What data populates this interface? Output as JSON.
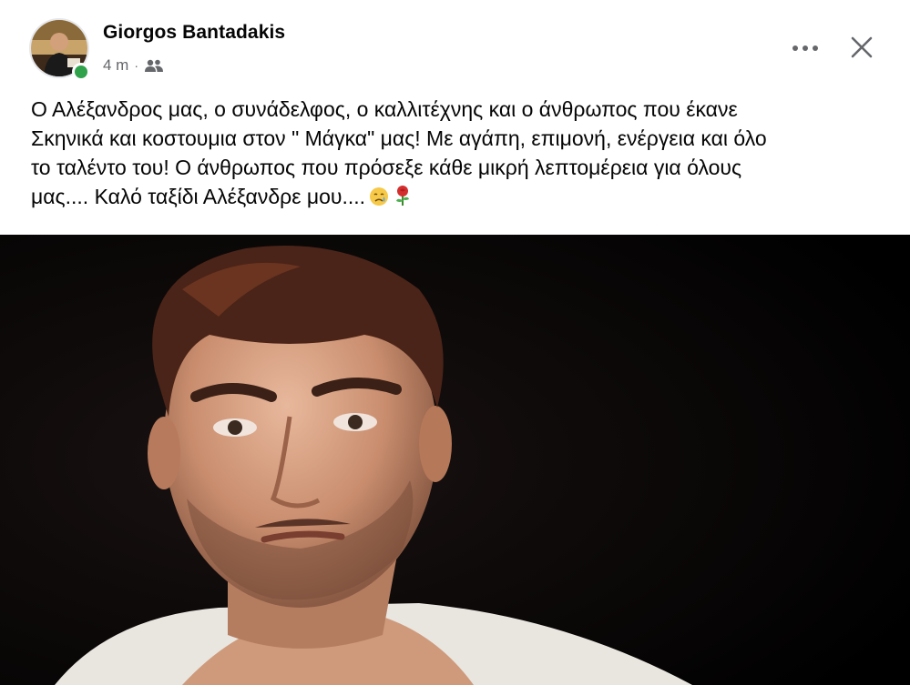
{
  "post": {
    "author_name": "Giorgos Bantadakis",
    "timestamp": "4 m",
    "separator": "·",
    "audience_icon": "friends-icon",
    "more_icon": "more-options-icon",
    "close_icon": "close-icon",
    "text_lines": [
      "Ο Αλέξανδρος μας, ο συνάδελφος, ο καλλιτέχνης και ο άνθρωπος που έκανε",
      "Σκηνικά και κοστουμια στον \" Μάγκα\" μας! Με αγάπη, επιμονή, ενέργεια και όλο",
      "το ταλέντο του! Ο άνθρωπος που πρόσεξε κάθε μικρή λεπτομέρεια για όλους",
      "μας.... Καλό ταξίδι Αλέξανδρε μου...."
    ],
    "emojis": [
      "sad-tear-emoji",
      "rose-emoji"
    ],
    "photo_icon": "portrait-photo"
  },
  "colors": {
    "online": "#31a24c",
    "secondary_text": "#65676b",
    "primary_text": "#050505",
    "photo_background": "#000000"
  }
}
